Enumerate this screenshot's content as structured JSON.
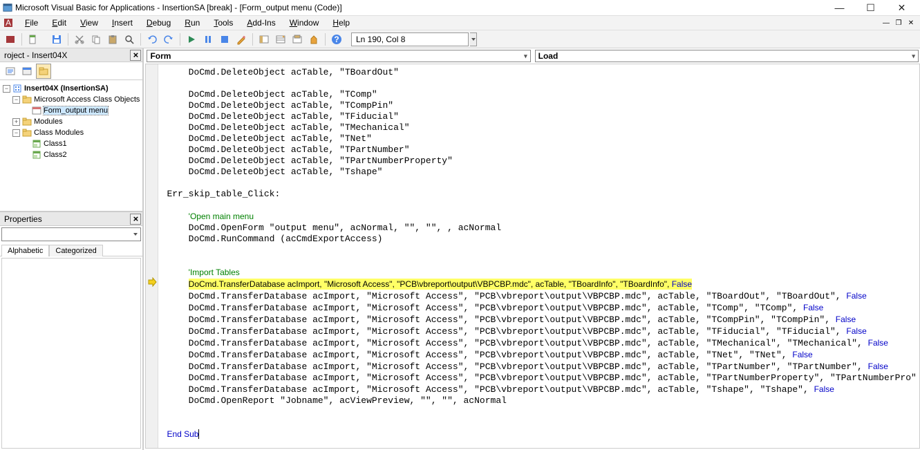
{
  "title": "Microsoft Visual Basic for Applications - InsertionSA [break] - [Form_output menu (Code)]",
  "menus": [
    "File",
    "Edit",
    "View",
    "Insert",
    "Debug",
    "Run",
    "Tools",
    "Add-Ins",
    "Window",
    "Help"
  ],
  "status": "Ln 190, Col 8",
  "project_panel_title": "roject - Insert04X",
  "properties_panel_title": "Properties",
  "prop_tabs": [
    "Alphabetic",
    "Categorized"
  ],
  "object_dd": "Form",
  "proc_dd": "Load",
  "tree": {
    "root": "Insert04X (InsertionSA)",
    "folders": [
      {
        "name": "Microsoft Access Class Objects",
        "children": [
          {
            "name": "Form_output menu",
            "icon": "form"
          }
        ]
      },
      {
        "name": "Modules",
        "children": []
      },
      {
        "name": "Class Modules",
        "children": [
          {
            "name": "Class1",
            "icon": "class"
          },
          {
            "name": "Class2",
            "icon": "class"
          }
        ]
      }
    ]
  },
  "code": {
    "indent": "    ",
    "lines": [
      {
        "t": "code",
        "s": "DoCmd.DeleteObject acTable, \"TBoardOut\""
      },
      {
        "t": "blank"
      },
      {
        "t": "code",
        "s": "DoCmd.DeleteObject acTable, \"TComp\""
      },
      {
        "t": "code",
        "s": "DoCmd.DeleteObject acTable, \"TCompPin\""
      },
      {
        "t": "code",
        "s": "DoCmd.DeleteObject acTable, \"TFiducial\""
      },
      {
        "t": "code",
        "s": "DoCmd.DeleteObject acTable, \"TMechanical\""
      },
      {
        "t": "code",
        "s": "DoCmd.DeleteObject acTable, \"TNet\""
      },
      {
        "t": "code",
        "s": "DoCmd.DeleteObject acTable, \"TPartNumber\""
      },
      {
        "t": "code",
        "s": "DoCmd.DeleteObject acTable, \"TPartNumberProperty\""
      },
      {
        "t": "code",
        "s": "DoCmd.DeleteObject acTable, \"Tshape\""
      },
      {
        "t": "blank"
      },
      {
        "t": "label",
        "s": "Err_skip_table_Click:"
      },
      {
        "t": "blank"
      },
      {
        "t": "comment",
        "s": "'Open main menu"
      },
      {
        "t": "code",
        "s": "DoCmd.OpenForm \"output menu\", acNormal, \"\", \"\", , acNormal"
      },
      {
        "t": "code",
        "s": "DoCmd.RunCommand (acCmdExportAccess)"
      },
      {
        "t": "blank"
      },
      {
        "t": "blank"
      },
      {
        "t": "comment",
        "s": "'Import Tables"
      },
      {
        "t": "hl",
        "s": "DoCmd.TransferDatabase acImport, \"Microsoft Access\", \"PCB\\vbreport\\output\\VBPCBP.mdc\", acTable, \"TBoardInfo\", \"TBoardInfo\", False",
        "arrow": true
      },
      {
        "t": "transfer",
        "tbl": "TBoardOut",
        "tbl2": "TBoardOut"
      },
      {
        "t": "transfer",
        "tbl": "TComp",
        "tbl2": "TComp"
      },
      {
        "t": "transfer",
        "tbl": "TCompPin",
        "tbl2": "TCompPin"
      },
      {
        "t": "transfer",
        "tbl": "TFiducial",
        "tbl2": "TFiducial"
      },
      {
        "t": "transfer",
        "tbl": "TMechanical",
        "tbl2": "TMechanical"
      },
      {
        "t": "transfer",
        "tbl": "TNet",
        "tbl2": "TNet"
      },
      {
        "t": "transfer",
        "tbl": "TPartNumber",
        "tbl2": "TPartNumber"
      },
      {
        "t": "transfer",
        "tbl": "TPartNumberProperty",
        "tbl2": "TPartNumberPro",
        "trunc": true
      },
      {
        "t": "transfer",
        "tbl": "Tshape",
        "tbl2": "Tshape"
      },
      {
        "t": "code",
        "s": "DoCmd.OpenReport \"Jobname\", acViewPreview, \"\", \"\", acNormal"
      },
      {
        "t": "blank"
      },
      {
        "t": "blank"
      },
      {
        "t": "end",
        "s": "End Sub",
        "caret": true
      }
    ]
  }
}
